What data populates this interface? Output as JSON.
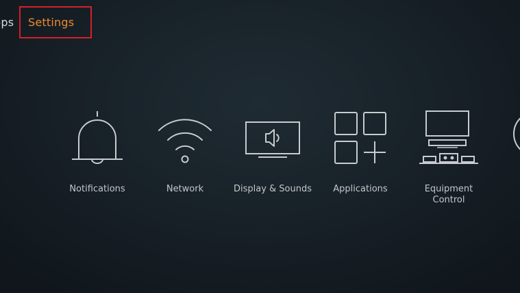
{
  "nav": {
    "apps_label": "pps",
    "settings_label": "Settings"
  },
  "tiles": [
    {
      "label": "Notifications",
      "icon": "bell-icon"
    },
    {
      "label": "Network",
      "icon": "wifi-icon"
    },
    {
      "label": "Display & Sounds",
      "icon": "tv-speaker-icon"
    },
    {
      "label": "Applications",
      "icon": "apps-grid-icon"
    },
    {
      "label": "Equipment\nControl",
      "icon": "equipment-icon"
    }
  ],
  "colors": {
    "accent": "#f08a2e",
    "highlight_border": "#d3202a",
    "icon_stroke": "#c7ccd0"
  }
}
